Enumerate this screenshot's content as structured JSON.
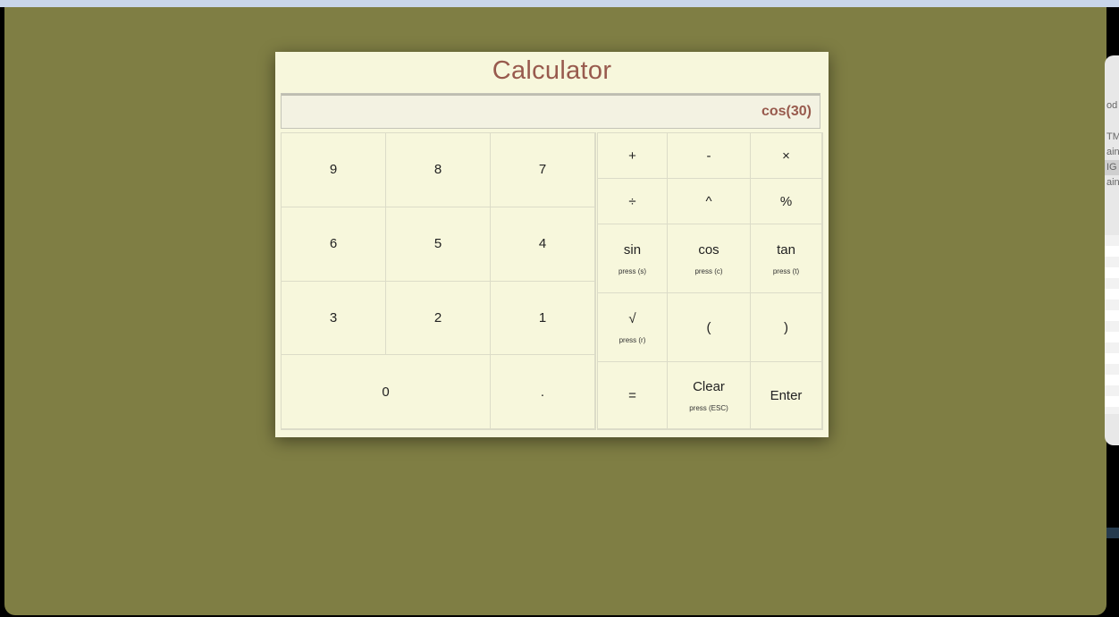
{
  "calculator": {
    "title": "Calculator",
    "display": "cos(30)",
    "numpad": [
      {
        "name": "key-9",
        "label": "9"
      },
      {
        "name": "key-8",
        "label": "8"
      },
      {
        "name": "key-7",
        "label": "7"
      },
      {
        "name": "key-6",
        "label": "6"
      },
      {
        "name": "key-5",
        "label": "5"
      },
      {
        "name": "key-4",
        "label": "4"
      },
      {
        "name": "key-3",
        "label": "3"
      },
      {
        "name": "key-2",
        "label": "2"
      },
      {
        "name": "key-1",
        "label": "1"
      },
      {
        "name": "key-0",
        "label": "0"
      },
      {
        "name": "key-decimal",
        "label": "."
      }
    ],
    "ops": [
      {
        "name": "key-plus",
        "label": "+"
      },
      {
        "name": "key-minus",
        "label": "-"
      },
      {
        "name": "key-multiply",
        "label": "×"
      },
      {
        "name": "key-divide",
        "label": "÷"
      },
      {
        "name": "key-power",
        "label": "^"
      },
      {
        "name": "key-percent",
        "label": "%"
      },
      {
        "name": "key-sin",
        "label": "sin",
        "hint": "press (s)"
      },
      {
        "name": "key-cos",
        "label": "cos",
        "hint": "press (c)"
      },
      {
        "name": "key-tan",
        "label": "tan",
        "hint": "press (t)"
      },
      {
        "name": "key-sqrt",
        "label": "√",
        "hint": "press (r)"
      },
      {
        "name": "key-open-paren",
        "label": "("
      },
      {
        "name": "key-close-paren",
        "label": ")"
      },
      {
        "name": "key-equals",
        "label": "="
      },
      {
        "name": "key-clear",
        "label": "Clear",
        "hint": "press (ESC)"
      },
      {
        "name": "key-enter",
        "label": "Enter"
      }
    ]
  },
  "side_panel": {
    "items": [
      "od",
      "TM",
      "ain",
      "IG",
      "ain"
    ]
  },
  "colors": {
    "background": "#7f7e44",
    "panel": "#f7f7dc",
    "accent": "#985a4d"
  }
}
